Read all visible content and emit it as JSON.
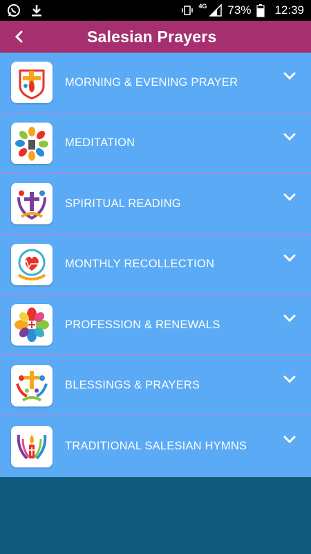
{
  "status_bar": {
    "network": "4G",
    "battery": "73%",
    "time": "12:39",
    "left_icons": [
      "whatsapp-icon",
      "download-icon"
    ]
  },
  "app_bar": {
    "title": "Salesian Prayers",
    "color": "#a6306f"
  },
  "list": {
    "background": "#5aaaf5",
    "items": [
      {
        "label": "MORNING & EVENING PRAYER",
        "icon": "cross-flame-icon"
      },
      {
        "label": "MEDITATION",
        "icon": "hands-circle-icon"
      },
      {
        "label": "SPIRITUAL READING",
        "icon": "cross-people-icon"
      },
      {
        "label": "MONTHLY RECOLLECTION",
        "icon": "heart-hands-icon"
      },
      {
        "label": "PROFESSION & RENEWALS",
        "icon": "flower-hands-icon"
      },
      {
        "label": "BLESSINGS & PRAYERS",
        "icon": "cross-family-icon"
      },
      {
        "label": "TRADITIONAL SALESIAN HYMNS",
        "icon": "candle-hands-icon"
      }
    ]
  }
}
